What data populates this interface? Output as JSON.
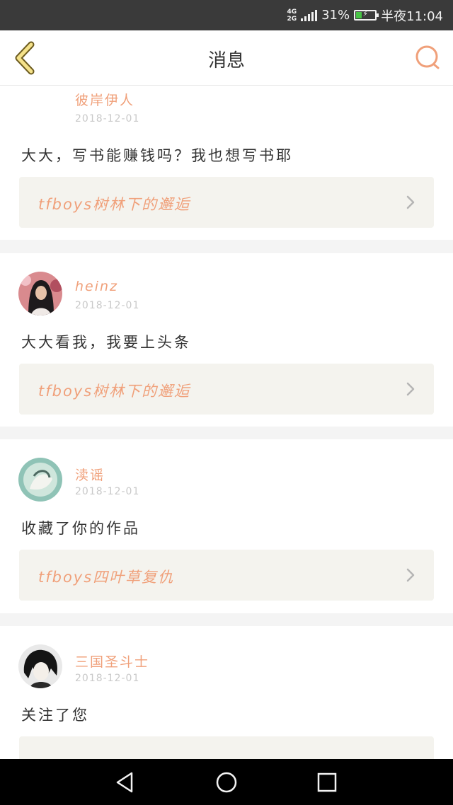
{
  "status_bar": {
    "network_top": "4G",
    "network_bottom": "2G",
    "battery_percent_text": "31%",
    "battery_level": 0.31,
    "time": "半夜11:04"
  },
  "header": {
    "title": "消息",
    "back_icon": "chevron-left-icon",
    "search_icon": "search-icon"
  },
  "messages": [
    {
      "name": "彼岸伊人",
      "date": "2018-12-01",
      "content": "大大，写书能赚钱吗？我也想写书耶",
      "book_title": "tfboys树林下的邂逅",
      "avatar": "avatar-hidden"
    },
    {
      "name": "heinz",
      "date": "2018-12-01",
      "content": "大大看我，我要上头条",
      "book_title": "tfboys树林下的邂逅",
      "avatar": "avatar-girl-photo"
    },
    {
      "name": "渎谣",
      "date": "2018-12-01",
      "content": "收藏了你的作品",
      "book_title": "tfboys四叶草复仇",
      "avatar": "avatar-anime-green"
    },
    {
      "name": "三国圣斗士",
      "date": "2018-12-01",
      "content": "关注了您",
      "book_title": "",
      "avatar": "avatar-anime-dark"
    }
  ],
  "nav": {
    "back": "triangle-back-icon",
    "home": "circle-home-icon",
    "recent": "square-recents-icon"
  },
  "colors": {
    "accent": "#f0a07a",
    "back_icon_fill": "#f5e28a",
    "book_bg": "#f4f3ee"
  }
}
